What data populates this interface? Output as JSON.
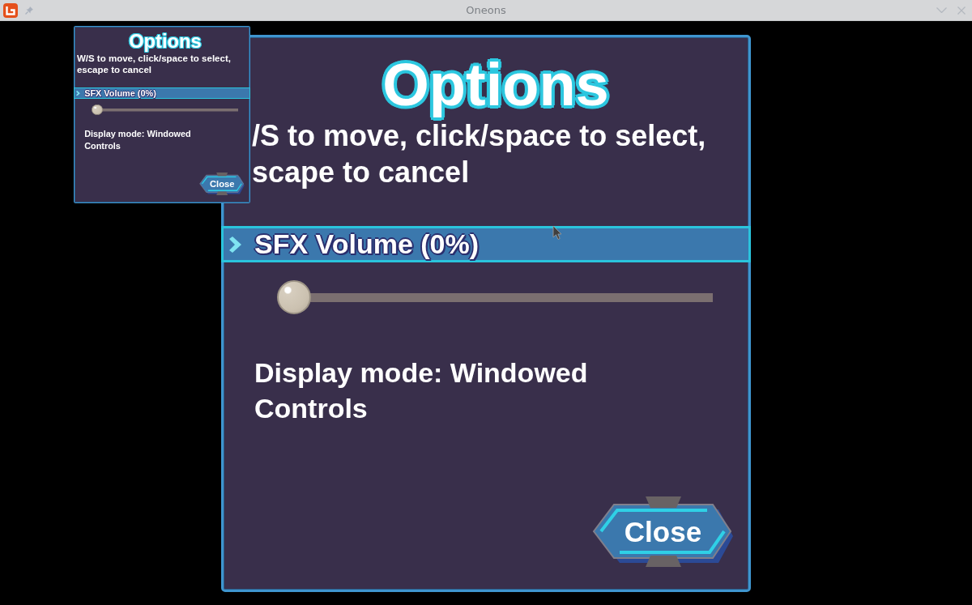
{
  "window": {
    "title": "Oneons"
  },
  "panels": [
    {
      "kind": "small",
      "title": "Options",
      "instructions": [
        "W/S to move, click/space to select,",
        "escape to cancel"
      ],
      "items": [
        {
          "kind": "slider",
          "label": "SFX Volume (0%)",
          "selected": true,
          "level": 0
        },
        {
          "kind": "label",
          "label": "Display mode: Windowed",
          "selected": false
        },
        {
          "kind": "label",
          "label": "Controls",
          "selected": false
        }
      ],
      "close_button": {
        "label": "Close"
      }
    },
    {
      "kind": "large",
      "title": "Options",
      "instructions": [
        "/S to move, click/space to select,",
        "scape to cancel"
      ],
      "items": [
        {
          "kind": "slider",
          "label": "SFX Volume (0%)",
          "selected": true,
          "level": 0
        },
        {
          "kind": "label",
          "label": "Display mode: Windowed",
          "selected": false
        },
        {
          "kind": "label",
          "label": "Controls",
          "selected": false
        }
      ],
      "close_button": {
        "label": "Close"
      }
    }
  ]
}
